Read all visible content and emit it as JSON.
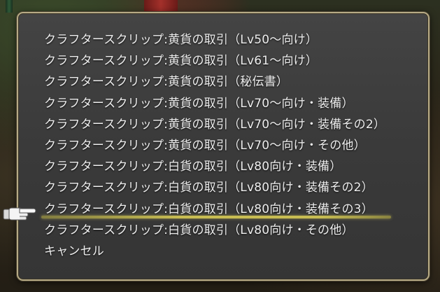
{
  "menu": {
    "items": [
      {
        "label": "クラフタースクリップ:黄貨の取引（Lv50～向け）"
      },
      {
        "label": "クラフタースクリップ:黄貨の取引（Lv61～向け）"
      },
      {
        "label": "クラフタースクリップ:黄貨の取引（秘伝書）"
      },
      {
        "label": "クラフタースクリップ:黄貨の取引（Lv70～向け・装備）"
      },
      {
        "label": "クラフタースクリップ:黄貨の取引（Lv70～向け・装備その2）"
      },
      {
        "label": "クラフタースクリップ:黄貨の取引（Lv70～向け・その他）"
      },
      {
        "label": "クラフタースクリップ:白貨の取引（Lv80向け・装備）"
      },
      {
        "label": "クラフタースクリップ:白貨の取引（Lv80向け・装備その2）"
      },
      {
        "label": "クラフタースクリップ:白貨の取引（Lv80向け・装備その3）"
      },
      {
        "label": "クラフタースクリップ:白貨の取引（Lv80向け・その他）"
      },
      {
        "label": "キャンセル"
      }
    ],
    "selected_index": 8
  },
  "cursor_icon": "pointing-hand-icon",
  "colors": {
    "menu_background": "#3c3c3c",
    "menu_border": "#b7ab86",
    "text": "#eeeeee",
    "selection_underline": "#c8bd52"
  }
}
